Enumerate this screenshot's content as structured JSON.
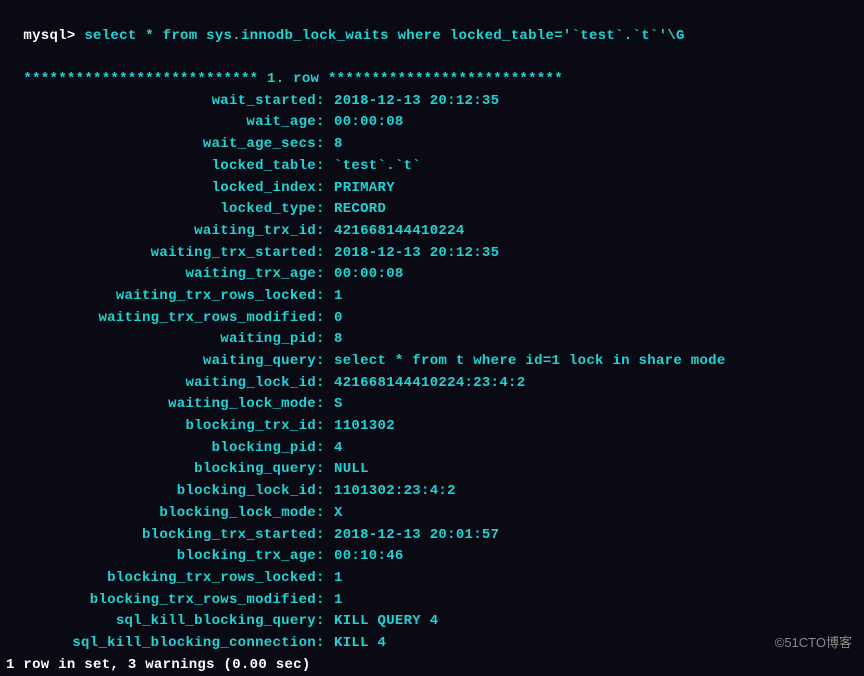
{
  "prompt": {
    "prefix": "mysql> ",
    "query": "select * from sys.innodb_lock_waits where locked_table='`test`.`t`'\\G"
  },
  "row_header": {
    "stars_left": "***************************",
    "label": " 1. row ",
    "stars_right": "***************************"
  },
  "fields": [
    {
      "key": "wait_started",
      "value": "2018-12-13 20:12:35"
    },
    {
      "key": "wait_age",
      "value": "00:00:08"
    },
    {
      "key": "wait_age_secs",
      "value": "8"
    },
    {
      "key": "locked_table",
      "value": "`test`.`t`"
    },
    {
      "key": "locked_index",
      "value": "PRIMARY"
    },
    {
      "key": "locked_type",
      "value": "RECORD"
    },
    {
      "key": "waiting_trx_id",
      "value": "421668144410224"
    },
    {
      "key": "waiting_trx_started",
      "value": "2018-12-13 20:12:35"
    },
    {
      "key": "waiting_trx_age",
      "value": "00:00:08"
    },
    {
      "key": "waiting_trx_rows_locked",
      "value": "1"
    },
    {
      "key": "waiting_trx_rows_modified",
      "value": "0"
    },
    {
      "key": "waiting_pid",
      "value": "8"
    },
    {
      "key": "waiting_query",
      "value": "select * from t where id=1 lock in share mode"
    },
    {
      "key": "waiting_lock_id",
      "value": "421668144410224:23:4:2"
    },
    {
      "key": "waiting_lock_mode",
      "value": "S"
    },
    {
      "key": "blocking_trx_id",
      "value": "1101302"
    },
    {
      "key": "blocking_pid",
      "value": "4"
    },
    {
      "key": "blocking_query",
      "value": "NULL"
    },
    {
      "key": "blocking_lock_id",
      "value": "1101302:23:4:2"
    },
    {
      "key": "blocking_lock_mode",
      "value": "X"
    },
    {
      "key": "blocking_trx_started",
      "value": "2018-12-13 20:01:57"
    },
    {
      "key": "blocking_trx_age",
      "value": "00:10:46"
    },
    {
      "key": "blocking_trx_rows_locked",
      "value": "1"
    },
    {
      "key": "blocking_trx_rows_modified",
      "value": "1"
    },
    {
      "key": "sql_kill_blocking_query",
      "value": "KILL QUERY 4"
    },
    {
      "key": "sql_kill_blocking_connection",
      "value": "KILL 4"
    }
  ],
  "footer": "1 row in set, 3 warnings (0.00 sec)",
  "watermark": "©51CTO博客"
}
